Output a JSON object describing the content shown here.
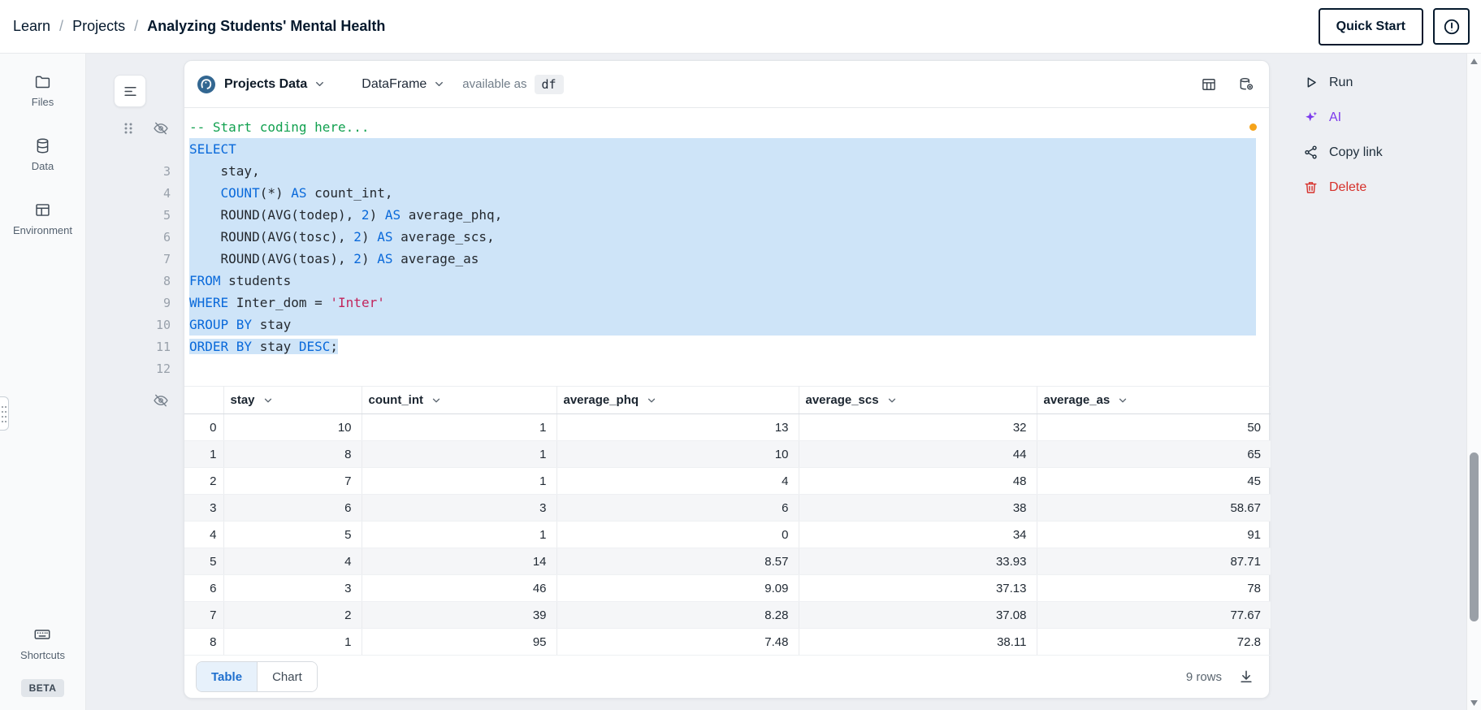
{
  "topbar": {
    "breadcrumb": [
      "Learn",
      "Projects",
      "Analyzing Students' Mental Health"
    ],
    "separator": "/",
    "quick_start_label": "Quick Start"
  },
  "sidebar": {
    "files_label": "Files",
    "data_label": "Data",
    "environment_label": "Environment",
    "shortcuts_label": "Shortcuts",
    "beta_label": "BETA"
  },
  "cell": {
    "header": {
      "source_label": "Projects Data",
      "output_type_label": "DataFrame",
      "available_as_label": "available as",
      "variable_name": "df"
    },
    "editor": {
      "lines": [
        {
          "num": "",
          "sel": "",
          "tokens": [
            [
              "com",
              "-- Start coding here..."
            ]
          ]
        },
        {
          "num": "",
          "sel": "full",
          "tokens": [
            [
              "kw",
              "SELECT"
            ]
          ]
        },
        {
          "num": "3",
          "sel": "full",
          "tokens": [
            [
              "id",
              "    stay,"
            ]
          ]
        },
        {
          "num": "4",
          "sel": "full",
          "tokens": [
            [
              "id",
              "    "
            ],
            [
              "kw",
              "COUNT"
            ],
            [
              "id",
              "(*) "
            ],
            [
              "kw",
              "AS"
            ],
            [
              "id",
              " count_int,"
            ]
          ]
        },
        {
          "num": "5",
          "sel": "full",
          "tokens": [
            [
              "id",
              "    ROUND(AVG(todep), "
            ],
            [
              "num",
              "2"
            ],
            [
              "id",
              ") "
            ],
            [
              "kw",
              "AS"
            ],
            [
              "id",
              " average_phq,"
            ]
          ]
        },
        {
          "num": "6",
          "sel": "full",
          "tokens": [
            [
              "id",
              "    ROUND(AVG(tosc), "
            ],
            [
              "num",
              "2"
            ],
            [
              "id",
              ") "
            ],
            [
              "kw",
              "AS"
            ],
            [
              "id",
              " average_scs,"
            ]
          ]
        },
        {
          "num": "7",
          "sel": "full",
          "tokens": [
            [
              "id",
              "    ROUND(AVG(toas), "
            ],
            [
              "num",
              "2"
            ],
            [
              "id",
              ") "
            ],
            [
              "kw",
              "AS"
            ],
            [
              "id",
              " average_as"
            ]
          ]
        },
        {
          "num": "8",
          "sel": "full",
          "tokens": [
            [
              "kw",
              "FROM"
            ],
            [
              "id",
              " students"
            ]
          ]
        },
        {
          "num": "9",
          "sel": "full",
          "tokens": [
            [
              "kw",
              "WHERE"
            ],
            [
              "id",
              " Inter_dom = "
            ],
            [
              "str",
              "'Inter'"
            ]
          ]
        },
        {
          "num": "10",
          "sel": "full",
          "tokens": [
            [
              "kw",
              "GROUP BY"
            ],
            [
              "id",
              " stay"
            ]
          ]
        },
        {
          "num": "11",
          "sel": "text",
          "tokens": [
            [
              "kw",
              "ORDER BY"
            ],
            [
              "id",
              " stay "
            ],
            [
              "kw",
              "DESC"
            ],
            [
              "id",
              ";"
            ]
          ]
        },
        {
          "num": "12",
          "sel": "",
          "tokens": []
        }
      ]
    },
    "result": {
      "columns": [
        "stay",
        "count_int",
        "average_phq",
        "average_scs",
        "average_as"
      ],
      "rows": [
        [
          "0",
          "10",
          "1",
          "13",
          "32",
          "50"
        ],
        [
          "1",
          "8",
          "1",
          "10",
          "44",
          "65"
        ],
        [
          "2",
          "7",
          "1",
          "4",
          "48",
          "45"
        ],
        [
          "3",
          "6",
          "3",
          "6",
          "38",
          "58.67"
        ],
        [
          "4",
          "5",
          "1",
          "0",
          "34",
          "91"
        ],
        [
          "5",
          "4",
          "14",
          "8.57",
          "33.93",
          "87.71"
        ],
        [
          "6",
          "3",
          "46",
          "9.09",
          "37.13",
          "78"
        ],
        [
          "7",
          "2",
          "39",
          "8.28",
          "37.08",
          "77.67"
        ],
        [
          "8",
          "1",
          "95",
          "7.48",
          "38.11",
          "72.8"
        ]
      ],
      "row_count_label": "9 rows"
    },
    "footer": {
      "table_tab_label": "Table",
      "chart_tab_label": "Chart"
    }
  },
  "actions": [
    {
      "name": "run",
      "label": "Run",
      "icon": "play-icon",
      "color": "#21303d"
    },
    {
      "name": "ai",
      "label": "AI",
      "icon": "sparkles-icon",
      "color": "#7c3aed"
    },
    {
      "name": "copy-link",
      "label": "Copy link",
      "icon": "share-icon",
      "color": "#21303d"
    },
    {
      "name": "delete",
      "label": "Delete",
      "icon": "trash-icon",
      "color": "#d6312b"
    }
  ],
  "colors": {
    "selection": "#cee4f8",
    "keyword": "#0969da",
    "string": "#c2255c",
    "comment": "#12a150",
    "accent_blue": "#1f6fce",
    "status_dot": "#f5a31a",
    "postgres_blue": "#336791"
  }
}
